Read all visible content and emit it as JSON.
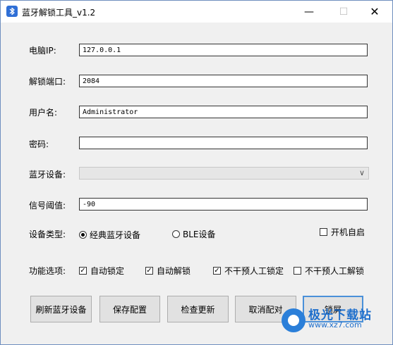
{
  "window": {
    "title": "蓝牙解锁工具_v1.2",
    "controls": {
      "minimize": "—",
      "maximize": "☐",
      "close": "✕"
    }
  },
  "form": {
    "ip_label": "电脑IP:",
    "ip_value": "127.0.0.1",
    "port_label": "解锁端口:",
    "port_value": "2084",
    "user_label": "用户名:",
    "user_value": "Administrator",
    "password_label": "密码:",
    "password_value": "",
    "bt_device_label": "蓝牙设备:",
    "bt_device_value": "",
    "threshold_label": "信号阈值:",
    "threshold_value": "-90"
  },
  "device_type": {
    "label": "设备类型:",
    "options": [
      {
        "label": "经典蓝牙设备",
        "selected": true
      },
      {
        "label": "BLE设备",
        "selected": false
      }
    ],
    "autostart": {
      "label": "开机自启",
      "checked": false
    }
  },
  "functions": {
    "label": "功能选项:",
    "options": [
      {
        "label": "自动锁定",
        "checked": true
      },
      {
        "label": "自动解锁",
        "checked": true
      },
      {
        "label": "不干预人工锁定",
        "checked": true
      },
      {
        "label": "不干预人工解锁",
        "checked": false
      }
    ]
  },
  "buttons": {
    "refresh": "刷新蓝牙设备",
    "save": "保存配置",
    "update": "检查更新",
    "unpair": "取消配对",
    "lock": "锁屏"
  },
  "watermark": {
    "name": "极光下载站",
    "url": "www.xz7.com"
  },
  "colors": {
    "accent": "#4a90d9",
    "bluetooth_icon": "#2f6fd6"
  }
}
